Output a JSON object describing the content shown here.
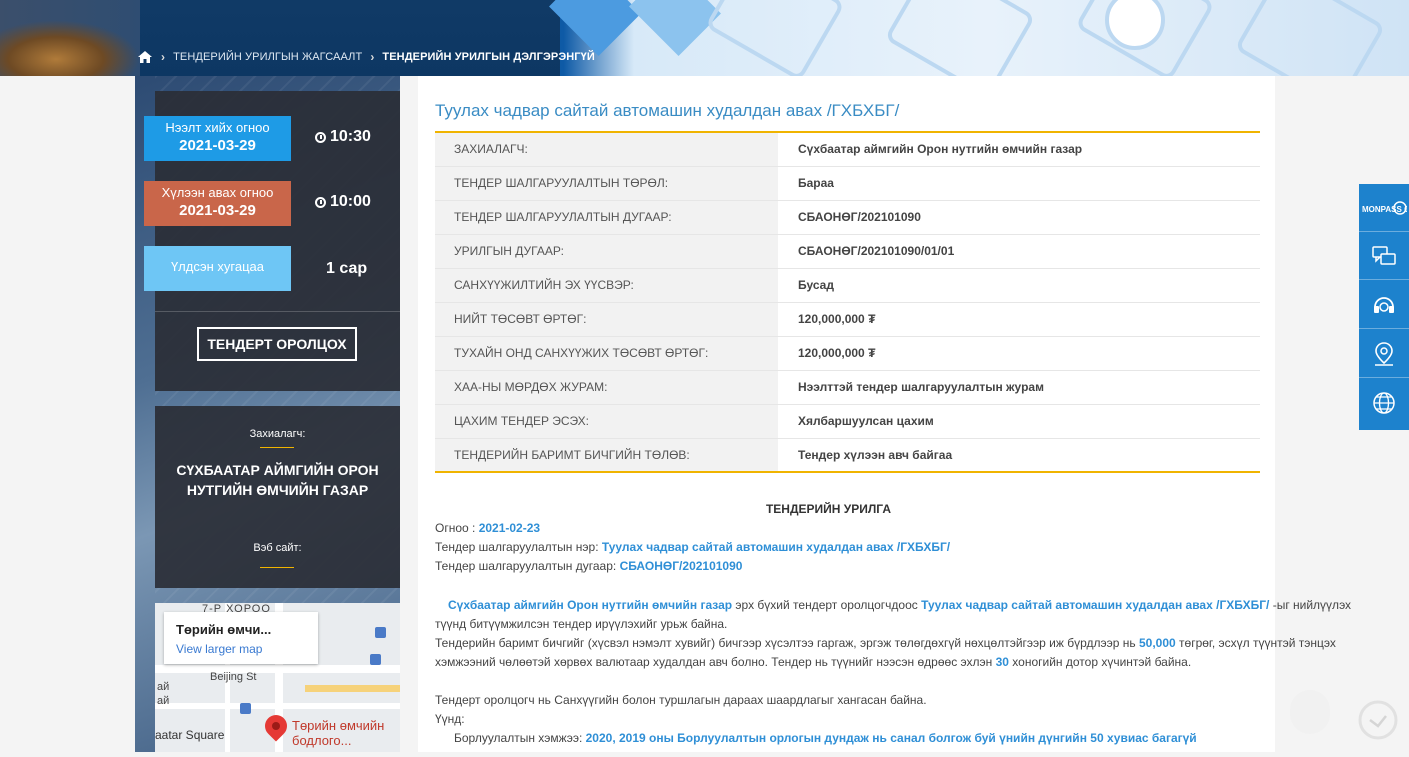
{
  "breadcrumb": {
    "items": [
      "ТЕНДЕРИЙН УРИЛГЫН ЖАГСААЛТ",
      "ТЕНДЕРИЙН УРИЛГЫН ДЭЛГЭРЭНГҮЙ"
    ]
  },
  "sidebar": {
    "open_date": {
      "label": "Нээлт хийх огноо",
      "date": "2021-03-29",
      "time": "10:30"
    },
    "deadline": {
      "label": "Хүлээн авах огноо",
      "date": "2021-03-29",
      "time": "10:00"
    },
    "remaining": {
      "label": "Үлдсэн хугацаа",
      "value": "1 сар"
    },
    "join_button": "ТЕНДЕРТ ОРОЛЦОХ",
    "customer_label": "Захиалагч:",
    "customer_name": "СҮХБААТАР АЙМГИЙН ОРОН НУТГИЙН ӨМЧИЙН ГАЗАР",
    "website_label": "Вэб сайт:"
  },
  "map": {
    "card_title": "Төрийн өмчи...",
    "card_link": "View larger map",
    "street_top": "7-Р ХОРОО",
    "street_1": "Beijing St",
    "label_left_1": "ай",
    "label_left_2": "ай",
    "label_square": "aatar Square",
    "pin_label_1": "Төрийн өмчийн",
    "pin_label_2": "бодлого..."
  },
  "main": {
    "title": "Туулах чадвар сайтай автомашин худалдан авах /ГХБХБГ/",
    "rows": [
      {
        "key": "ЗАХИАЛАГЧ:",
        "value": "Сүхбаатар аймгийн Орон нутгийн өмчийн газар"
      },
      {
        "key": "ТЕНДЕР ШАЛГАРУУЛАЛТЫН ТӨРӨЛ:",
        "value": "Бараа"
      },
      {
        "key": "ТЕНДЕР ШАЛГАРУУЛАЛТЫН ДУГААР:",
        "value": "СБАОНӨГ/202101090"
      },
      {
        "key": "УРИЛГЫН ДУГААР:",
        "value": "СБАОНӨГ/202101090/01/01"
      },
      {
        "key": "САНХҮҮЖИЛТИЙН ЭХ ҮҮСВЭР:",
        "value": "Бусад"
      },
      {
        "key": "НИЙТ ТӨСӨВТ ӨРТӨГ:",
        "value": "120,000,000 ₮"
      },
      {
        "key": "ТУХАЙН ОНД САНХҮҮЖИХ ТӨСӨВТ ӨРТӨГ:",
        "value": "120,000,000 ₮"
      },
      {
        "key": "ХАА-НЫ МӨРДӨХ ЖУРАМ:",
        "value": "Нээлттэй тендер шалгаруулалтын журам"
      },
      {
        "key": "ЦАХИМ ТЕНДЕР ЭСЭХ:",
        "value": "Хялбаршуулсан цахим"
      },
      {
        "key": "ТЕНДЕРИЙН БАРИМТ БИЧГИЙН ТӨЛӨВ:",
        "value": "Тендер хүлээн авч байгаа"
      }
    ],
    "notice": {
      "heading": "ТЕНДЕРИЙН УРИЛГА",
      "date_label": "Огноо : ",
      "date_value": "2021-02-23",
      "name_label": "Тендер шалгаруулалтын нэр: ",
      "name_value": "Туулах чадвар сайтай автомашин худалдан авах /ГХБХБГ/",
      "number_label": "Тендер шалгаруулалтын дугаар: ",
      "number_value": "СБАОНӨГ/202101090",
      "p1_org": "Сүхбаатар аймгийн Орон нутгийн өмчийн газар",
      "p1_mid": " эрх бүхий тендерт оролцогчдоос ",
      "p1_name": "Туулах чадвар сайтай автомашин худалдан авах /ГХБХБГ/",
      "p1_end": " -ыг нийлүүлэх",
      "p1_line2": "түүнд битүүмжилсэн тендер ирүүлэхийг урьж байна.",
      "p2_start": "Тендерийн баримт бичгийг (хүсвэл нэмэлт хувийг) бичгээр хүсэлтээ гаргаж, эргэж төлөгдөхгүй нөхцөлтэйгээр иж бүрдлээр  нь ",
      "p2_fee": "50,000",
      "p2_end": " төгрөг, эсхүл түүнтэй тэнцэх",
      "p3_start": "хэмжээний чөлөөтэй хөрвөх валютаар худалдан авч болно. Тендер нь түүнийг нээсэн өдрөөс эхлэн ",
      "p3_days": "30",
      "p3_end": " хоногийн дотор хүчинтэй байна.",
      "p4": "Тендерт оролцогч нь Санхүүгийн болон туршлагын дараах шаардлагыг хангасан байна.",
      "p5": "Үүнд:",
      "p6_label": "Борлуулалтын хэмжээ: ",
      "p6_value": "2020, 2019 оны Борлуулалтын орлогын дундаж нь санал болгож буй үнийн дүнгийн 50 хувиас багагүй"
    }
  },
  "toolbar": {
    "items": [
      "monpass-ca-icon",
      "chat-icon",
      "support-headset-icon",
      "location-pin-icon",
      "globe-icon"
    ],
    "monpass_text": "MONPASS CA"
  },
  "colors": {
    "accent_blue": "#2f8fd6",
    "gold": "#f0b400",
    "open_date_bg": "#1e9be6",
    "deadline_bg": "#c9664a",
    "remaining_bg": "#6ec6f5"
  }
}
